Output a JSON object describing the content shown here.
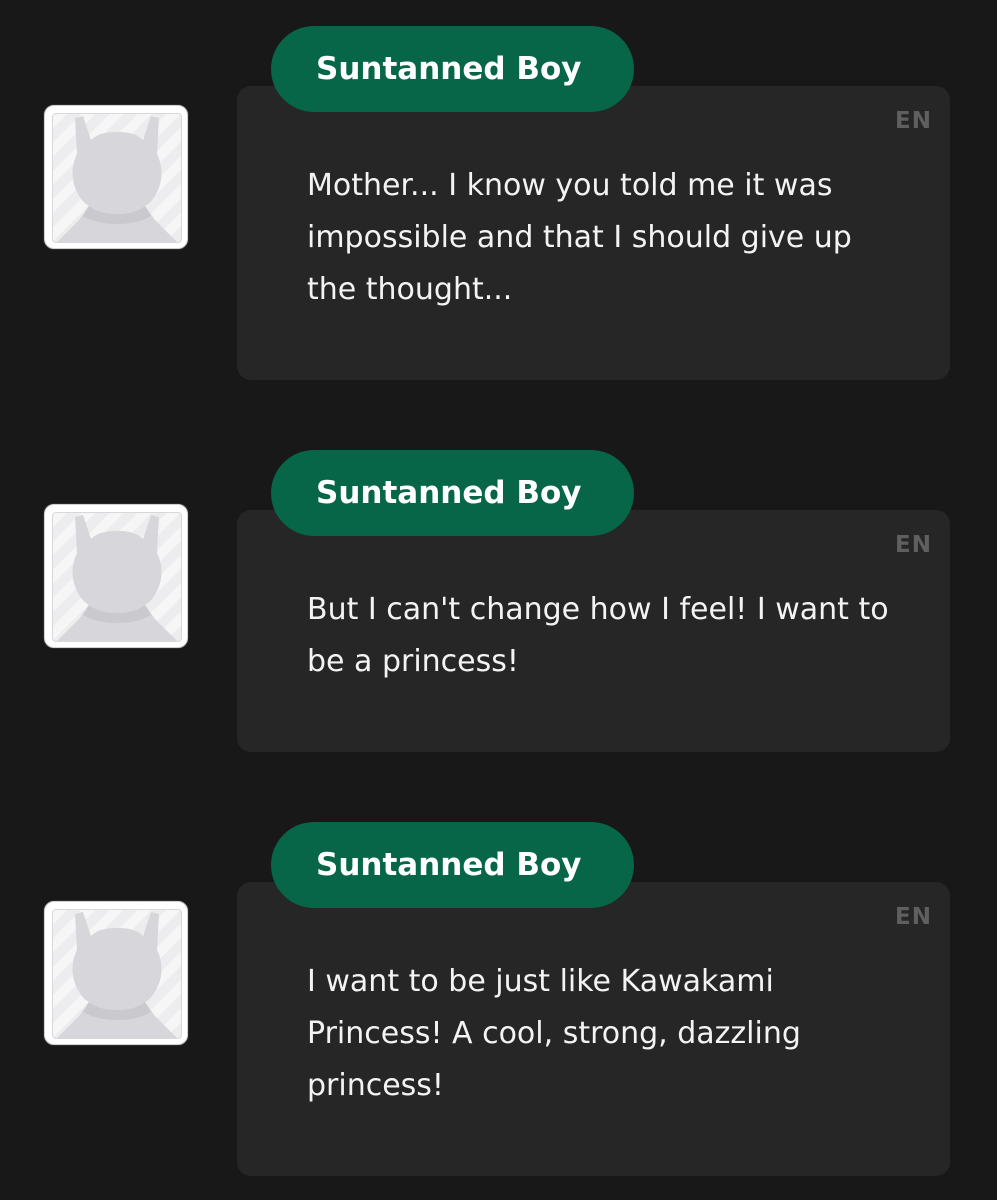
{
  "messages": [
    {
      "speaker": "Suntanned Boy",
      "language": "EN",
      "text": "Mother... I know you told me it was impossible and that I should give up the thought..."
    },
    {
      "speaker": "Suntanned Boy",
      "language": "EN",
      "text": "But I can't change how I feel! I want to be a princess!"
    },
    {
      "speaker": "Suntanned Boy",
      "language": "EN",
      "text": "I want to be just like Kawakami Princess! A cool, strong, dazzling princess!"
    }
  ],
  "avatar_icon": "silhouette-icon",
  "colors": {
    "background": "#181818",
    "bubble": "#262626",
    "name_tag": "#076647",
    "text": "#f3f3f3",
    "language_label": "#5f5f5f"
  }
}
